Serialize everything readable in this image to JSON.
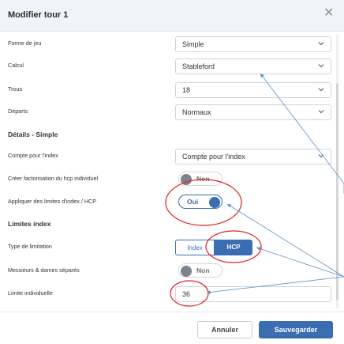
{
  "dialog": {
    "title": "Modifier tour 1"
  },
  "form": {
    "forme_de_jeu": {
      "label": "Forme de jeu",
      "value": "Simple"
    },
    "calcul": {
      "label": "Calcul",
      "value": "Stableford"
    },
    "trous": {
      "label": "Trous",
      "value": "18"
    },
    "departs": {
      "label": "Départs",
      "value": "Normaux"
    }
  },
  "details": {
    "title": "Détails - Simple",
    "compte_index": {
      "label": "Compte pour l'index",
      "value": "Compte pour l'index"
    },
    "creer_factorisation": {
      "label": "Créer factorisation du hcp individuel",
      "state": "Non"
    },
    "appliquer_limites": {
      "label": "Appliquer des limites d'index / HCP",
      "state": "Oui"
    }
  },
  "limites": {
    "title": "Limites index",
    "type_limitation": {
      "label": "Type de limitation",
      "options": [
        "Index",
        "HCP"
      ],
      "selected": "HCP"
    },
    "messieurs_dames": {
      "label": "Messieurs & dames séparés",
      "state": "Non"
    },
    "limite_individuelle": {
      "label": "Limite individuelle",
      "value": "36"
    }
  },
  "footer": {
    "cancel_label": "Annuler",
    "save_label": "Sauvegarder"
  },
  "colors": {
    "accent": "#3b6db3",
    "annotation_red": "#e02020",
    "annotation_arrow": "#5b8fc7"
  },
  "icons": {
    "close": "close-icon",
    "dropdown": "chevron-down-icon"
  }
}
